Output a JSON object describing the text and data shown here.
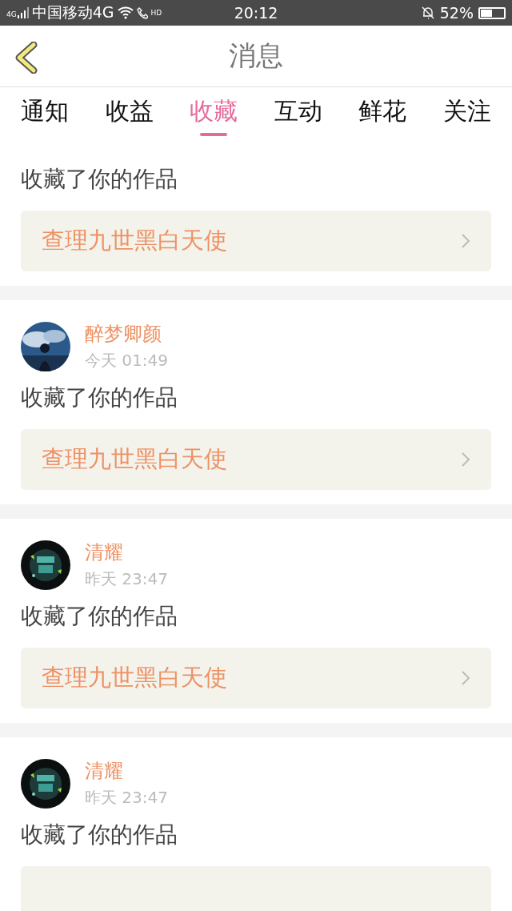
{
  "status_bar": {
    "signal_label": "4G",
    "carrier": "中国移动4G",
    "call_label": "HD",
    "time": "20:12",
    "battery": "52%"
  },
  "header": {
    "title": "消息"
  },
  "tabs": [
    {
      "label": "通知",
      "selected": false
    },
    {
      "label": "收益",
      "selected": false
    },
    {
      "label": "收藏",
      "selected": true
    },
    {
      "label": "互动",
      "selected": false
    },
    {
      "label": "鲜花",
      "selected": false
    },
    {
      "label": "关注",
      "selected": false
    }
  ],
  "messages": [
    {
      "action": "收藏了你的作品",
      "work": "查理九世黑白天使"
    },
    {
      "user": "醉梦卿颜",
      "time": "今天 01:49",
      "action": "收藏了你的作品",
      "work": "查理九世黑白天使"
    },
    {
      "user": "清耀",
      "time": "昨天 23:47",
      "action": "收藏了你的作品",
      "work": "查理九世黑白天使"
    },
    {
      "user": "清耀",
      "time": "昨天 23:47",
      "action": "收藏了你的作品"
    }
  ]
}
